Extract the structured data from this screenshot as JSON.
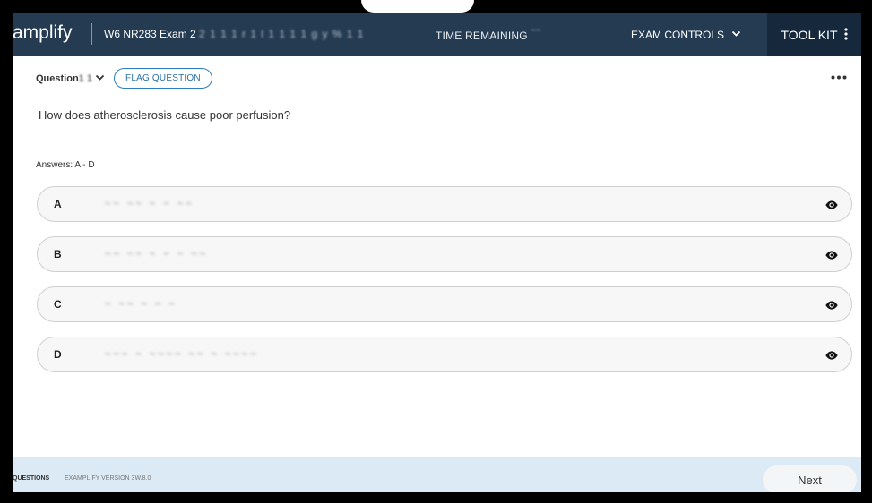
{
  "header": {
    "logo": "amplify",
    "exam_title": "W6 NR283 Exam 2",
    "exam_title_obscured": "2 1 1 1 r 1 l 1 1 1 1 g y % 1 1",
    "time_remaining_label": "TIME REMAINING",
    "time_remaining_value": "~~",
    "exam_controls_label": "EXAM CONTROLS",
    "toolkit_label": "TOOL KIT"
  },
  "question": {
    "number_label": "Question",
    "number_obscured": "1 1",
    "flag_label": "FLAG QUESTION",
    "text": "How does atherosclerosis cause poor perfusion?",
    "answers_label": "Answers: A - D"
  },
  "answers": [
    {
      "letter": "A",
      "text": "~~   ~~   ~ ~   ~~"
    },
    {
      "letter": "B",
      "text": "~~   ~~ ~   ~ ~   ~~"
    },
    {
      "letter": "C",
      "text": "~   ~~   ~   ~ ~"
    },
    {
      "letter": "D",
      "text": "~~~ ~ ~~~~ ~~ ~ ~~~~"
    }
  ],
  "footer": {
    "questions_label": "QUESTIONS",
    "version_label": "EXAMPLIFY VERSION 3W.8.0",
    "next_label": "Next"
  },
  "icons": {
    "eye": "eye-icon",
    "chevron": "chevron-down-icon",
    "kebab": "more-vertical-icon",
    "more": "more-horizontal-icon"
  },
  "colors": {
    "topbar": "#253b52",
    "toolkit": "#15283c",
    "accent": "#2b7fbf",
    "footer": "#dbeaf5"
  }
}
